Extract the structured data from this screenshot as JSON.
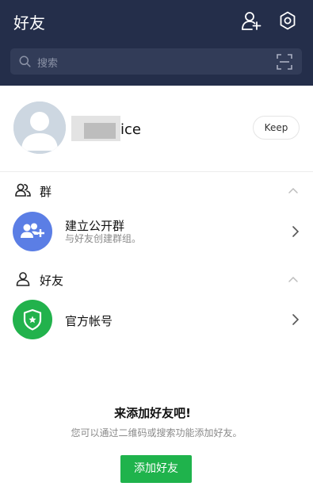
{
  "header": {
    "title": "好友",
    "icons": {
      "add_friend": "add-friend-icon",
      "settings": "gear-icon"
    }
  },
  "search": {
    "placeholder": "搜索",
    "icons": {
      "search": "search-icon",
      "scan": "qr-scan-icon"
    }
  },
  "profile": {
    "name": "ice",
    "keep_label": "Keep"
  },
  "groups": {
    "section_label": "群",
    "create": {
      "title": "建立公开群",
      "subtitle": "与好友创建群组。"
    }
  },
  "friends": {
    "section_label": "好友",
    "official": {
      "title": "官方帐号"
    }
  },
  "empty_state": {
    "title": "来添加好友吧!",
    "description": "您可以通过二维码或搜索功能添加好友。",
    "button_label": "添加好友"
  },
  "colors": {
    "header_bg": "#242e4a",
    "search_bg": "#323c58",
    "group_icon_bg": "#5b7ee5",
    "official_icon_bg": "#22b24c",
    "add_button_bg": "#1fb34c"
  }
}
